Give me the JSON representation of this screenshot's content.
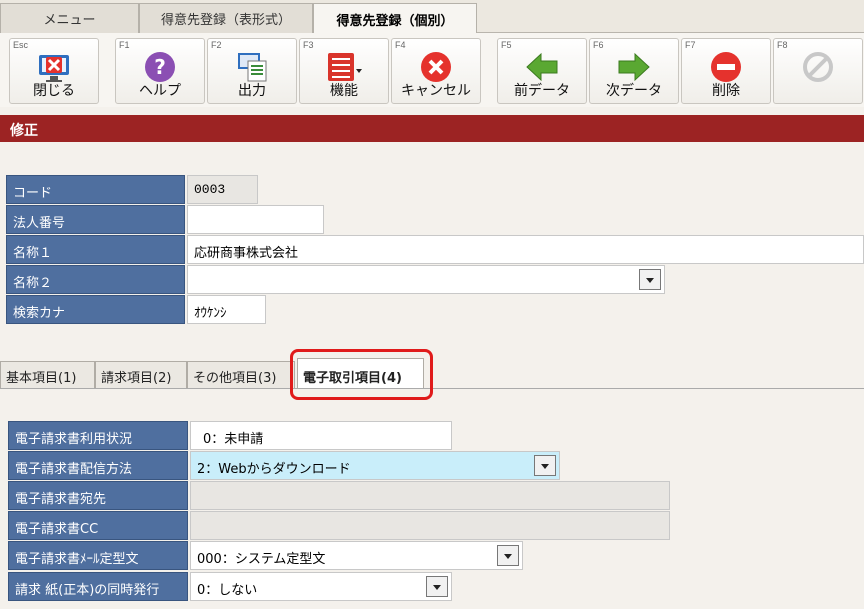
{
  "top_tabs": [
    {
      "label": "メニュー"
    },
    {
      "label": "得意先登録（表形式）"
    },
    {
      "label": "得意先登録（個別）"
    }
  ],
  "toolbar": {
    "buttons": [
      {
        "key": "Esc",
        "label": "閉じる",
        "icon": "close-window-icon"
      },
      {
        "key": "F1",
        "label": "ヘルプ",
        "icon": "help-icon"
      },
      {
        "key": "F2",
        "label": "出力",
        "icon": "output-icon"
      },
      {
        "key": "F3",
        "label": "機能",
        "icon": "function-menu-icon"
      },
      {
        "key": "F4",
        "label": "キャンセル",
        "icon": "cancel-icon"
      },
      {
        "key": "F5",
        "label": "前データ",
        "icon": "arrow-left-icon"
      },
      {
        "key": "F6",
        "label": "次データ",
        "icon": "arrow-right-icon"
      },
      {
        "key": "F7",
        "label": "削除",
        "icon": "delete-icon"
      },
      {
        "key": "F8",
        "label": "",
        "icon": "disabled-icon"
      }
    ]
  },
  "mode": {
    "label": "修正"
  },
  "header_fields": {
    "code": {
      "label": "コード",
      "value": "0003"
    },
    "corp_number": {
      "label": "法人番号",
      "value": ""
    },
    "name1": {
      "label": "名称１",
      "value": "応研商事株式会社"
    },
    "name2": {
      "label": "名称２",
      "value": ""
    },
    "kana": {
      "label": "検索カナ",
      "value": "ｵｳｹﾝｼ"
    }
  },
  "sub_tabs": [
    {
      "label": "基本項目(1)"
    },
    {
      "label": "請求項目(2)"
    },
    {
      "label": "その他項目(3)"
    },
    {
      "label": "電子取引項目(4)"
    }
  ],
  "detail_fields": {
    "usage": {
      "label": "電子請求書利用状況",
      "value": "0：未申請"
    },
    "delivery": {
      "label": "電子請求書配信方法",
      "value": "2：Webからダウンロード"
    },
    "to": {
      "label": "電子請求書宛先",
      "value": ""
    },
    "cc": {
      "label": "電子請求書CC",
      "value": ""
    },
    "mail_template": {
      "label": "電子請求書ﾒｰﾙ定型文",
      "value": "000：システム定型文"
    },
    "paper": {
      "label": "請求 紙(正本)の同時発行",
      "value": "0：しない"
    }
  },
  "colors": {
    "mode_bar": "#9c2323",
    "label_bg": "#4f6f9f",
    "highlight": "#e01b1b",
    "selected_field": "#c9eefa"
  }
}
